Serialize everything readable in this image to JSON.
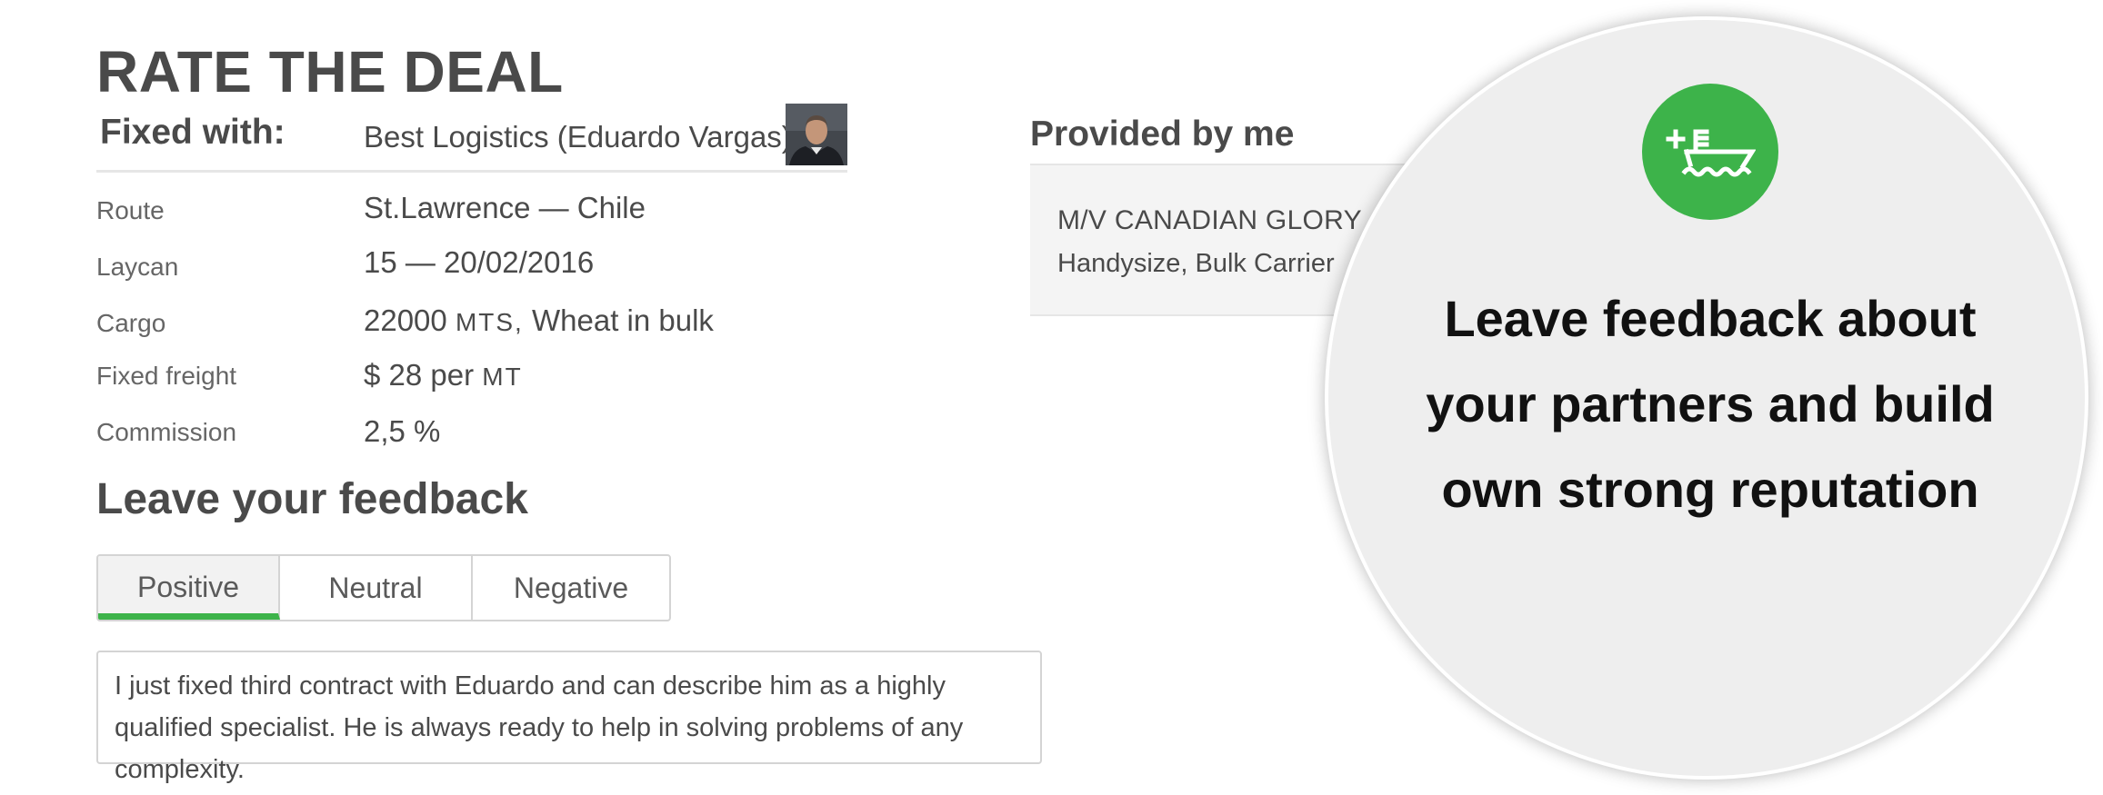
{
  "page_title": "RATE THE DEAL",
  "deal": {
    "fixed_with_label": "Fixed with:",
    "fixed_with_value": "Best Logistics (Eduardo Vargas)",
    "route_label": "Route",
    "route_value": "St.Lawrence — Chile",
    "laycan_label": "Laycan",
    "laycan_value": "15 — 20/02/2016",
    "cargo_label": "Cargo",
    "cargo_amount": "22000",
    "cargo_unit": "MTS,",
    "cargo_desc": "Wheat in bulk",
    "freight_label": "Fixed freight",
    "freight_currency": "$",
    "freight_amount": "28",
    "freight_per": "per",
    "freight_unit": "MT",
    "commission_label": "Commission",
    "commission_value": "2,5 %"
  },
  "feedback": {
    "title": "Leave your feedback",
    "tabs": [
      "Positive",
      "Neutral",
      "Negative"
    ],
    "selected_tab": "Positive",
    "text": "I just fixed third contract with Eduardo and can describe him as a highly qualified specialist. He is always ready to help in solving problems of any complexity."
  },
  "provided": {
    "title": "Provided by me",
    "vessel_name": "M/V CANADIAN GLORY",
    "vessel_type": "Handysize, Bulk Carrier"
  },
  "promo": {
    "icon": "ship-add-icon",
    "text": "Leave feedback about your partners and build own strong reputation"
  },
  "colors": {
    "accent": "#3db34a",
    "text": "#4a4a4a",
    "circle_bg": "#eeeeee"
  }
}
